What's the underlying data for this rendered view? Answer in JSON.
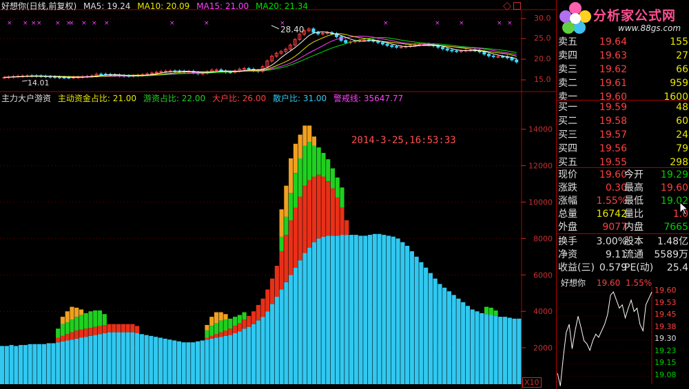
{
  "top_header": {
    "title": "好想你(日线,前复权)",
    "ma5": "MA5: 19.24",
    "ma10": "MA10: 20.09",
    "ma15": "MA15: 21.00",
    "ma20": "MA20: 21.34"
  },
  "top_chart": {
    "y_ticks": [
      "30.0",
      "25.0",
      "20.0",
      "15.0"
    ],
    "high_label": "28.40",
    "low_label": "14.01",
    "ma_colors": {
      "ma5": "#ffffff",
      "ma10": "#e8e800",
      "ma15": "#ff40ff",
      "ma20": "#00e000"
    }
  },
  "bottom_header": {
    "indicator": "主力大户游资",
    "zhudong": "主动资金占比: 21.00",
    "youzi": "游资占比: 22.00",
    "dahu": "大户比: 26.00",
    "sanhu": "散户比: 31.00",
    "jingjie": "警戒线: 35647.77"
  },
  "timestamp": "2014-3-25,16:53:33",
  "multiplier_label": "X10",
  "chart_data": {
    "type": "bar",
    "stacked": true,
    "ylim": [
      0,
      15500
    ],
    "y_ticks": [
      2000,
      4000,
      6000,
      8000,
      10000,
      12000,
      14000
    ],
    "series": [
      {
        "name": "散户比",
        "color": "#30c8f0"
      },
      {
        "name": "大户比",
        "color": "#e83018"
      },
      {
        "name": "游资占比",
        "color": "#20d020"
      },
      {
        "name": "主动资金占比",
        "color": "#f0a020"
      }
    ],
    "blue": [
      2100,
      2100,
      2150,
      2100,
      2150,
      2150,
      2200,
      2200,
      2200,
      2200,
      2250,
      2250,
      2300,
      2350,
      2400,
      2450,
      2500,
      2550,
      2600,
      2650,
      2700,
      2750,
      2800,
      2850,
      2850,
      2850,
      2850,
      2850,
      2850,
      2800,
      2750,
      2700,
      2650,
      2600,
      2550,
      2500,
      2450,
      2400,
      2350,
      2300,
      2300,
      2300,
      2350,
      2400,
      2450,
      2500,
      2550,
      2600,
      2650,
      2700,
      2800,
      2900,
      3050,
      3150,
      3300,
      3500,
      3700,
      4000,
      4400,
      4800,
      5200,
      5600,
      6000,
      6400,
      6800,
      7200,
      7500,
      7800,
      8000,
      8100,
      8150,
      8150,
      8150,
      8200,
      8200,
      8200,
      8200,
      8150,
      8150,
      8200,
      8250,
      8250,
      8200,
      8150,
      8100,
      8000,
      7800,
      7600,
      7300,
      7000,
      6700,
      6400,
      6100,
      5800,
      5500,
      5300,
      5100,
      4900,
      4700,
      4500,
      4300,
      4100,
      4000,
      3900,
      3850,
      3800,
      3750,
      3700,
      3700,
      3650,
      3600,
      3600
    ],
    "red": [
      0,
      0,
      0,
      0,
      0,
      0,
      0,
      0,
      0,
      0,
      0,
      0,
      250,
      300,
      350,
      400,
      450,
      450,
      450,
      450,
      450,
      450,
      450,
      450,
      450,
      450,
      450,
      450,
      450,
      400,
      0,
      0,
      0,
      0,
      0,
      0,
      0,
      0,
      0,
      0,
      0,
      0,
      0,
      0,
      100,
      150,
      200,
      250,
      300,
      350,
      400,
      450,
      500,
      600,
      700,
      850,
      1000,
      1200,
      1400,
      1700,
      2100,
      2600,
      3000,
      3300,
      3500,
      3700,
      3700,
      3600,
      3500,
      3300,
      3000,
      2600,
      2100,
      1500,
      800,
      0,
      0,
      0,
      0,
      0,
      0,
      0,
      0,
      0,
      0,
      0,
      0,
      0,
      0,
      0,
      0,
      0,
      0,
      0,
      0,
      0,
      0,
      0,
      0,
      0,
      0,
      0,
      0,
      0,
      0,
      0,
      0,
      0,
      0,
      0,
      0,
      0
    ],
    "green": [
      0,
      0,
      0,
      0,
      0,
      0,
      0,
      0,
      0,
      0,
      0,
      0,
      500,
      650,
      650,
      700,
      750,
      800,
      850,
      900,
      900,
      850,
      600,
      0,
      0,
      0,
      0,
      0,
      0,
      0,
      0,
      0,
      0,
      0,
      0,
      0,
      0,
      0,
      0,
      0,
      0,
      0,
      0,
      0,
      400,
      550,
      600,
      650,
      600,
      550,
      500,
      450,
      400,
      0,
      0,
      0,
      0,
      0,
      0,
      0,
      800,
      1000,
      1500,
      1900,
      2100,
      2200,
      2100,
      1700,
      1500,
      1300,
      1200,
      1100,
      1100,
      1100,
      0,
      0,
      0,
      0,
      0,
      0,
      0,
      0,
      0,
      0,
      0,
      0,
      0,
      0,
      0,
      0,
      0,
      0,
      0,
      0,
      0,
      0,
      0,
      0,
      0,
      0,
      0,
      0,
      0,
      0,
      400,
      400,
      300,
      0,
      0,
      0,
      0,
      0
    ],
    "orange": [
      0,
      0,
      0,
      0,
      0,
      0,
      0,
      0,
      0,
      0,
      0,
      0,
      0,
      400,
      600,
      700,
      500,
      300,
      0,
      0,
      0,
      0,
      0,
      0,
      0,
      0,
      0,
      0,
      0,
      0,
      0,
      0,
      0,
      0,
      0,
      0,
      0,
      0,
      0,
      0,
      0,
      0,
      0,
      0,
      300,
      500,
      600,
      450,
      300,
      0,
      0,
      0,
      0,
      0,
      0,
      0,
      0,
      0,
      0,
      0,
      1500,
      1700,
      1900,
      1600,
      1300,
      1100,
      900,
      500,
      0,
      0,
      0,
      0,
      0,
      0,
      0,
      0,
      0,
      0,
      0,
      0,
      0,
      0,
      0,
      0,
      0,
      0,
      0,
      0,
      0,
      0,
      0,
      0,
      0,
      0,
      0,
      0,
      0,
      0,
      0,
      0,
      0,
      0,
      0,
      0,
      0,
      0,
      0,
      0,
      0,
      0,
      0,
      0
    ]
  },
  "order_book": {
    "sell": [
      {
        "label": "卖五",
        "price": "19.64",
        "vol": "155"
      },
      {
        "label": "卖四",
        "price": "19.63",
        "vol": "27"
      },
      {
        "label": "卖三",
        "price": "19.62",
        "vol": "66"
      },
      {
        "label": "卖二",
        "price": "19.61",
        "vol": "959"
      },
      {
        "label": "卖一",
        "price": "19.60",
        "vol": "1600"
      }
    ],
    "buy": [
      {
        "label": "买一",
        "price": "19.59",
        "vol": "48"
      },
      {
        "label": "买二",
        "price": "19.58",
        "vol": "60"
      },
      {
        "label": "买三",
        "price": "19.57",
        "vol": "24"
      },
      {
        "label": "买四",
        "price": "19.56",
        "vol": "79"
      },
      {
        "label": "买五",
        "price": "19.55",
        "vol": "298"
      }
    ]
  },
  "quote": {
    "xianjia_k": "现价",
    "xianjia_v": "19.60",
    "jinkai_k": "今开",
    "jinkai_v": "19.29",
    "zhangdie_k": "涨跌",
    "zhangdie_v": "0.30",
    "zuigao_k": "最高",
    "zuigao_v": "19.60",
    "zhangfu_k": "涨幅",
    "zhangfu_v": "1.55%",
    "zuidi_k": "最低",
    "zuidi_v": "19.02",
    "zongliang_k": "总量",
    "zongliang_v": "16742",
    "liangbi_k": "量比",
    "liangbi_v": "1.0",
    "waipan_k": "外盘",
    "waipan_v": "9077",
    "neipan_k": "内盘",
    "neipan_v": "7665",
    "huanshou_k": "换手",
    "huanshou_v": "3.00%",
    "guben_k": "股本",
    "guben_v": "1.48亿",
    "jingzi_k": "净资",
    "jingzi_v": "9.11",
    "liutong_k": "流通",
    "liutong_v": "5589万",
    "shouyi_k": "收益(三)",
    "shouyi_v": "0.579",
    "pe_k": "PE(动)",
    "pe_v": "25.4"
  },
  "mini_chart": {
    "name": "好想你",
    "price": "19.60",
    "pct": "1.55%",
    "y_ticks": [
      "19.60",
      "19.53",
      "19.45",
      "19.38",
      "19.30",
      "19.23",
      "19.15",
      "19.08"
    ]
  },
  "logo": {
    "text": "分析家公式网",
    "url": "www.88gs.com"
  }
}
